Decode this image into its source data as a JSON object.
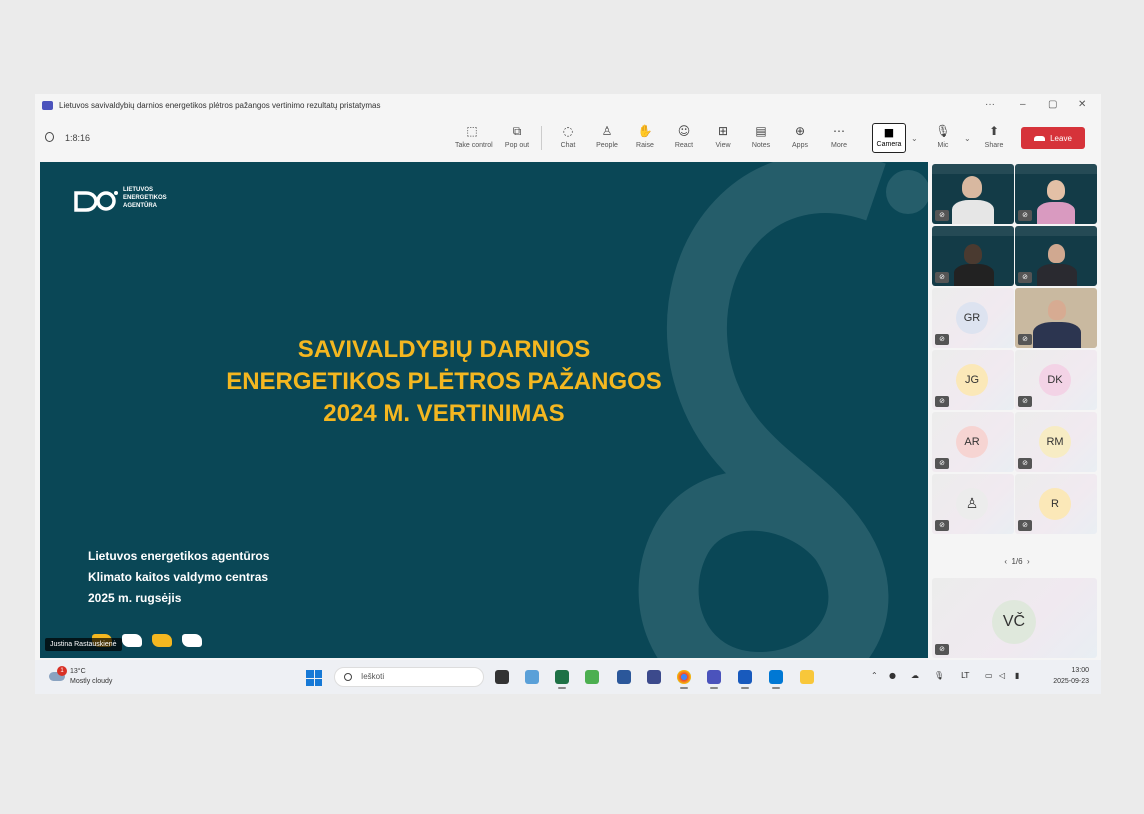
{
  "window": {
    "title": "Lietuvos savivaldybių darnios energetikos plėtros pažangos vertinimo rezultatų pristatymas",
    "controls": {
      "more": "···",
      "minimize": "–",
      "restore": "▢",
      "close": "✕"
    }
  },
  "toolbar": {
    "timer": "1:8:16",
    "buttons": [
      {
        "label": "Take control",
        "icon": "take-control-icon"
      },
      {
        "label": "Pop out",
        "icon": "pop-out-icon"
      },
      {
        "label": "Chat",
        "icon": "chat-icon"
      },
      {
        "label": "People",
        "icon": "people-icon"
      },
      {
        "label": "Raise",
        "icon": "raise-hand-icon"
      },
      {
        "label": "React",
        "icon": "react-icon"
      },
      {
        "label": "View",
        "icon": "view-icon"
      },
      {
        "label": "Notes",
        "icon": "notes-icon"
      },
      {
        "label": "Apps",
        "icon": "apps-icon"
      },
      {
        "label": "More",
        "icon": "more-icon"
      }
    ],
    "camera_label": "Camera",
    "mic_label": "Mic",
    "share_label": "Share",
    "leave_label": "Leave",
    "leave_color": "#d6333a"
  },
  "slide": {
    "brand_lines": [
      "LIETUVOS",
      "ENERGETIKOS",
      "AGENTŪRA"
    ],
    "title_lines": [
      "SAVIVALDYBIŲ DARNIOS",
      "ENERGETIKOS PLĖTROS PAŽANGOS",
      "2024 M. VERTINIMAS"
    ],
    "subtitle_lines": [
      "Lietuvos energetikos agentūros",
      "Klimato kaitos valdymo centras",
      "2025 m. rugsėjis"
    ],
    "presenter": "Justina Rastauskienė",
    "background_color": "#0a4756",
    "title_color": "#f4b720"
  },
  "participants": {
    "initials": [
      "GR",
      "JG",
      "DK",
      "AR",
      "RM",
      "R"
    ],
    "pager": "1/6",
    "pager_prev": "‹",
    "pager_next": "›",
    "spotlight_initials": "VČ"
  },
  "taskbar": {
    "weather_badge": "1",
    "temperature": "13°C",
    "weather": "Mostly cloudy",
    "search_placeholder": "Ieškoti",
    "language": "LT",
    "time": "13:00",
    "date": "2025-09-23"
  }
}
